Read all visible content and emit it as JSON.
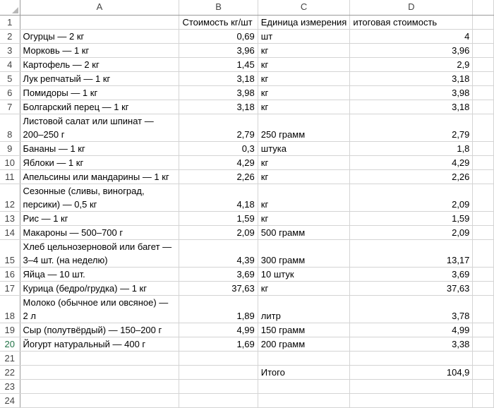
{
  "columns": [
    "A",
    "B",
    "C",
    "D"
  ],
  "header_row": {
    "b": "Стоимость кг/шт",
    "c": "Единица измерения",
    "d": "итоговая стоимость"
  },
  "rows": [
    {
      "n": "2",
      "a": [
        "Огурцы — 2 кг"
      ],
      "b": "0,69",
      "c": "шт",
      "d": "4"
    },
    {
      "n": "3",
      "a": [
        "Морковь — 1 кг"
      ],
      "b": "3,96",
      "c": "кг",
      "d": "3,96"
    },
    {
      "n": "4",
      "a": [
        "Картофель — 2 кг"
      ],
      "b": "1,45",
      "c": "кг",
      "d": "2,9"
    },
    {
      "n": "5",
      "a": [
        "Лук репчатый — 1 кг"
      ],
      "b": "3,18",
      "c": "кг",
      "d": "3,18"
    },
    {
      "n": "6",
      "a": [
        "Помидоры — 1 кг"
      ],
      "b": "3,98",
      "c": "кг",
      "d": "3,98"
    },
    {
      "n": "7",
      "a": [
        "Болгарский перец — 1 кг"
      ],
      "b": "3,18",
      "c": "кг",
      "d": "3,18"
    },
    {
      "n": "8",
      "a": [
        "Листовой салат или шпинат —",
        "200–250 г"
      ],
      "b": "2,79",
      "c": "250 грамм",
      "d": "2,79"
    },
    {
      "n": "9",
      "a": [
        "Бананы — 1 кг"
      ],
      "b": "0,3",
      "c": "штука",
      "d": "1,8"
    },
    {
      "n": "10",
      "a": [
        "Яблоки — 1 кг"
      ],
      "b": "4,29",
      "c": "кг",
      "d": "4,29"
    },
    {
      "n": "11",
      "a": [
        "Апельсины или мандарины — 1 кг"
      ],
      "b": "2,26",
      "c": "кг",
      "d": "2,26"
    },
    {
      "n": "12",
      "a": [
        "Сезонные (сливы, виноград,",
        "персики) — 0,5 кг"
      ],
      "b": "4,18",
      "c": "кг",
      "d": "2,09"
    },
    {
      "n": "13",
      "a": [
        "Рис — 1 кг"
      ],
      "b": "1,59",
      "c": "кг",
      "d": "1,59"
    },
    {
      "n": "14",
      "a": [
        "Макароны — 500–700 г"
      ],
      "b": "2,09",
      "c": "500 грамм",
      "d": "2,09"
    },
    {
      "n": "15",
      "a": [
        "Хлеб цельнозерновой или багет —",
        "3–4 шт. (на неделю)"
      ],
      "b": "4,39",
      "c": "300 грамм",
      "d": "13,17"
    },
    {
      "n": "16",
      "a": [
        "Яйца — 10 шт."
      ],
      "b": "3,69",
      "c": "10 штук",
      "d": "3,69"
    },
    {
      "n": "17",
      "a": [
        "Курица (бедро/грудка) — 1 кг"
      ],
      "b": "37,63",
      "c": "кг",
      "d": "37,63"
    },
    {
      "n": "18",
      "a": [
        "Молоко (обычное или овсяное) —",
        "2 л"
      ],
      "b": "1,89",
      "c": "литр",
      "d": "3,78"
    },
    {
      "n": "19",
      "a": [
        "Сыр (полутвёрдый) — 150–200 г"
      ],
      "b": "4,99",
      "c": "150 грамм",
      "d": "4,99"
    },
    {
      "n": "20",
      "a": [
        "Йогурт натуральный — 400 г"
      ],
      "b": "1,69",
      "c": "200 грамм",
      "d": "3,38"
    },
    {
      "n": "21",
      "a": [
        ""
      ],
      "b": "",
      "c": "",
      "d": ""
    },
    {
      "n": "22",
      "a": [
        ""
      ],
      "b": "",
      "c": "Итого",
      "d": "104,9"
    },
    {
      "n": "23",
      "a": [
        ""
      ],
      "b": "",
      "c": "",
      "d": ""
    },
    {
      "n": "24",
      "a": [
        ""
      ],
      "b": "",
      "c": "",
      "d": ""
    }
  ],
  "selected_row": "20"
}
